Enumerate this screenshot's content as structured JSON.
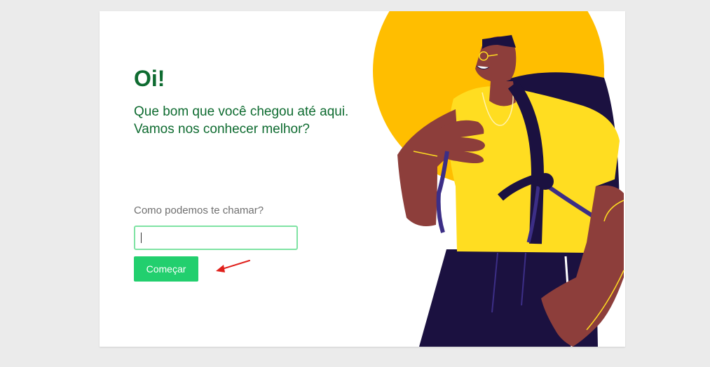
{
  "greeting": {
    "title": "Oi!",
    "line1": "Que bom que você chegou até aqui.",
    "line2": "Vamos nos conhecer melhor?"
  },
  "form": {
    "name_label": "Como podemos te chamar?",
    "name_value": "",
    "name_placeholder": "",
    "submit_label": "Começar"
  },
  "colors": {
    "brand_green": "#0e6b30",
    "button_green": "#22cf6e",
    "input_border": "#7fe3a3",
    "sun_yellow": "#ffbe00",
    "shirt_yellow": "#ffdd21",
    "backpack_navy": "#1b1140",
    "skin_brown": "#8d3e3b",
    "annotation_red": "#e0201b"
  },
  "icons": {
    "annotation": "red-arrow-icon",
    "illustration": "backpacker-illustration"
  }
}
